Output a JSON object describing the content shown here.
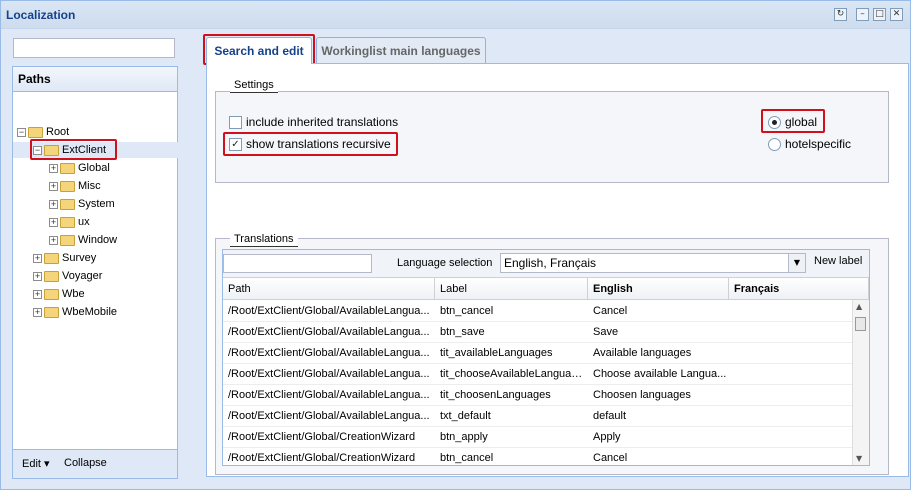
{
  "window": {
    "title": "Localization",
    "tools": [
      "↻",
      "–",
      "□",
      "✕"
    ]
  },
  "left": {
    "search_value": "",
    "paths_title": "Paths",
    "tree": [
      {
        "label": "Root",
        "level": 0,
        "expanded": true
      },
      {
        "label": "ExtClient",
        "level": 1,
        "expanded": true,
        "selected": true
      },
      {
        "label": "Global",
        "level": 2,
        "expanded": false
      },
      {
        "label": "Misc",
        "level": 2,
        "expanded": false
      },
      {
        "label": "System",
        "level": 2,
        "expanded": false
      },
      {
        "label": "ux",
        "level": 2,
        "expanded": false
      },
      {
        "label": "Window",
        "level": 2,
        "expanded": false
      },
      {
        "label": "Survey",
        "level": 1,
        "expanded": false
      },
      {
        "label": "Voyager",
        "level": 1,
        "expanded": false
      },
      {
        "label": "Wbe",
        "level": 1,
        "expanded": false
      },
      {
        "label": "WbeMobile",
        "level": 1,
        "expanded": false
      }
    ],
    "footer": {
      "edit": "Edit ▾",
      "collapse": "Collapse"
    }
  },
  "tabs": [
    {
      "label": "Search and edit",
      "active": true
    },
    {
      "label": "Workinglist main languages",
      "active": false
    }
  ],
  "settings": {
    "legend": "Settings",
    "include_inherited": {
      "label": "include inherited translations",
      "checked": false
    },
    "show_recursive": {
      "label": "show translations recursive",
      "checked": true
    },
    "global": {
      "label": "global",
      "selected": true
    },
    "hotelspecific": {
      "label": "hotelspecific",
      "selected": false
    }
  },
  "translations": {
    "legend": "Translations",
    "filter_value": "",
    "language_selection_label": "Language selection",
    "language_value": "English, Français",
    "new_label": "New label",
    "columns": [
      "Path",
      "Label",
      "English",
      "Français"
    ],
    "rows": [
      [
        "/Root/ExtClient/Global/AvailableLangua...",
        "btn_cancel",
        "Cancel",
        ""
      ],
      [
        "/Root/ExtClient/Global/AvailableLangua...",
        "btn_save",
        "Save",
        ""
      ],
      [
        "/Root/ExtClient/Global/AvailableLangua...",
        "tit_availableLanguages",
        "Available languages",
        ""
      ],
      [
        "/Root/ExtClient/Global/AvailableLangua...",
        "tit_chooseAvailableLanguages",
        "Choose available Langua...",
        ""
      ],
      [
        "/Root/ExtClient/Global/AvailableLangua...",
        "tit_choosenLanguages",
        "Choosen languages",
        ""
      ],
      [
        "/Root/ExtClient/Global/AvailableLangua...",
        "txt_default",
        "default",
        ""
      ],
      [
        "/Root/ExtClient/Global/CreationWizard",
        "btn_apply",
        "Apply",
        ""
      ],
      [
        "/Root/ExtClient/Global/CreationWizard",
        "btn_cancel",
        "Cancel",
        ""
      ]
    ]
  },
  "colors": {
    "highlight": "#d0101a",
    "accent": "#15428b",
    "border": "#99bbe8"
  }
}
